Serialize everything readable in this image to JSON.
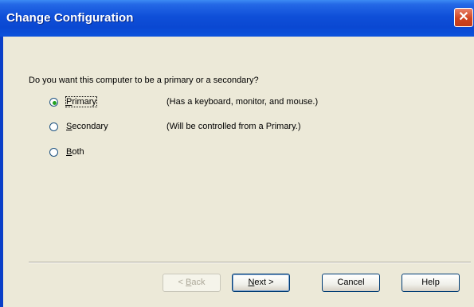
{
  "window": {
    "title": "Change Configuration",
    "close_glyph": "✕"
  },
  "prompt": "Do you want this computer to be a primary or a secondary?",
  "options": [
    {
      "label_pre": "",
      "label_key": "P",
      "label_post": "rimary",
      "description": "(Has a keyboard, monitor, and mouse.)",
      "selected": true
    },
    {
      "label_pre": "",
      "label_key": "S",
      "label_post": "econdary",
      "description": "(Will be controlled from a Primary.)",
      "selected": false
    },
    {
      "label_pre": "",
      "label_key": "B",
      "label_post": "oth",
      "description": "",
      "selected": false
    }
  ],
  "buttons": {
    "back": {
      "pre": "< ",
      "key": "B",
      "post": "ack"
    },
    "next": {
      "pre": "",
      "key": "N",
      "post": "ext >"
    },
    "cancel": "Cancel",
    "help": "Help"
  },
  "colors": {
    "titlebar": "#0A48D2",
    "face": "#ECE9D8",
    "close": "#D0441F",
    "radio_dot": "#21A121"
  }
}
